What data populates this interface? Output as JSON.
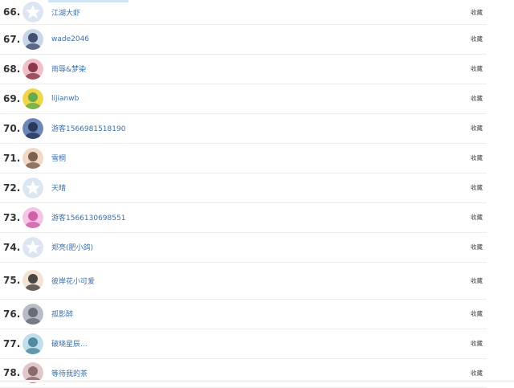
{
  "rows": [
    {
      "rank": "66.",
      "name": "江湖大虾",
      "fav": "收藏",
      "avatar": "default-star"
    },
    {
      "rank": "67.",
      "name": "wade2046",
      "fav": "收藏",
      "avatar": "photo"
    },
    {
      "rank": "68.",
      "name": "雨辱&梦染",
      "fav": "收藏",
      "avatar": "photo"
    },
    {
      "rank": "69.",
      "name": "lijianwb",
      "fav": "收藏",
      "avatar": "photo"
    },
    {
      "rank": "70.",
      "name": "游客1566981518190",
      "fav": "收藏",
      "avatar": "photo"
    },
    {
      "rank": "71.",
      "name": "雪桐",
      "fav": "收藏",
      "avatar": "photo"
    },
    {
      "rank": "72.",
      "name": "天晴",
      "fav": "收藏",
      "avatar": "default-star"
    },
    {
      "rank": "73.",
      "name": "游客1566130698551",
      "fav": "收藏",
      "avatar": "photo"
    },
    {
      "rank": "74.",
      "name": "郑亮(肥小鸽)",
      "fav": "收藏",
      "avatar": "default-star"
    },
    {
      "rank": "75.",
      "name": "彼岸花小可爱",
      "fav": "收藏",
      "avatar": "photo"
    },
    {
      "rank": "76.",
      "name": "孤影醉",
      "fav": "收藏",
      "avatar": "photo"
    },
    {
      "rank": "77.",
      "name": "破晓星辰...",
      "fav": "收藏",
      "avatar": "photo"
    },
    {
      "rank": "78.",
      "name": "等待我的茶",
      "fav": "收藏",
      "avatar": "photo"
    }
  ],
  "colors": {
    "link": "#3a6fa8",
    "default_avatar_bg": "#dbe6f2",
    "divider": "#ececec"
  }
}
